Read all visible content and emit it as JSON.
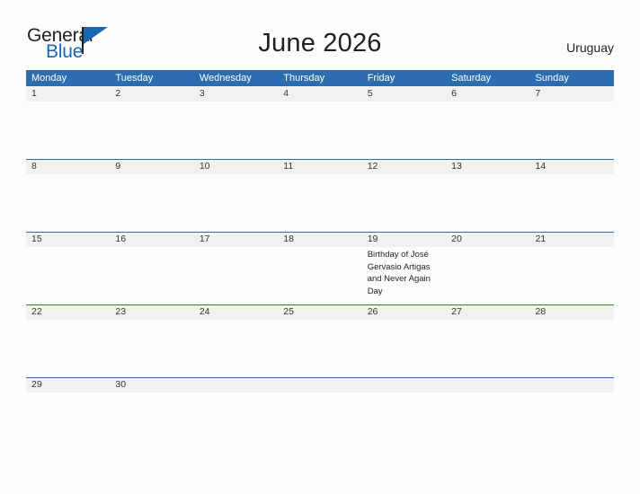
{
  "brand": {
    "name_part1": "General",
    "name_part2": "Blue",
    "accent_color": "#1668b3",
    "flag_icon": "flag-triangle-icon"
  },
  "header": {
    "title": "June 2026",
    "country": "Uruguay"
  },
  "colors": {
    "header_blue": "#2b6daf",
    "band_gray": "#f1f1f1",
    "text_dark": "#231f20",
    "page_background": "#fdfdfd"
  },
  "calendar": {
    "weekday_headers": [
      "Monday",
      "Tuesday",
      "Wednesday",
      "Thursday",
      "Friday",
      "Saturday",
      "Sunday"
    ],
    "weeks": [
      {
        "days": [
          {
            "num": "1",
            "events": []
          },
          {
            "num": "2",
            "events": []
          },
          {
            "num": "3",
            "events": []
          },
          {
            "num": "4",
            "events": []
          },
          {
            "num": "5",
            "events": []
          },
          {
            "num": "6",
            "events": []
          },
          {
            "num": "7",
            "events": []
          }
        ]
      },
      {
        "days": [
          {
            "num": "8",
            "events": []
          },
          {
            "num": "9",
            "events": []
          },
          {
            "num": "10",
            "events": []
          },
          {
            "num": "11",
            "events": []
          },
          {
            "num": "12",
            "events": []
          },
          {
            "num": "13",
            "events": []
          },
          {
            "num": "14",
            "events": []
          }
        ]
      },
      {
        "days": [
          {
            "num": "15",
            "events": []
          },
          {
            "num": "16",
            "events": []
          },
          {
            "num": "17",
            "events": []
          },
          {
            "num": "18",
            "events": []
          },
          {
            "num": "19",
            "events": [
              "Birthday of José Gervasio Artigas and Never Again Day"
            ]
          },
          {
            "num": "20",
            "events": []
          },
          {
            "num": "21",
            "events": []
          }
        ]
      },
      {
        "days": [
          {
            "num": "22",
            "events": []
          },
          {
            "num": "23",
            "events": []
          },
          {
            "num": "24",
            "events": []
          },
          {
            "num": "25",
            "events": []
          },
          {
            "num": "26",
            "events": []
          },
          {
            "num": "27",
            "events": []
          },
          {
            "num": "28",
            "events": []
          }
        ]
      },
      {
        "days": [
          {
            "num": "29",
            "events": []
          },
          {
            "num": "30",
            "events": []
          },
          {
            "num": "",
            "events": []
          },
          {
            "num": "",
            "events": []
          },
          {
            "num": "",
            "events": []
          },
          {
            "num": "",
            "events": []
          },
          {
            "num": "",
            "events": []
          }
        ]
      }
    ]
  }
}
